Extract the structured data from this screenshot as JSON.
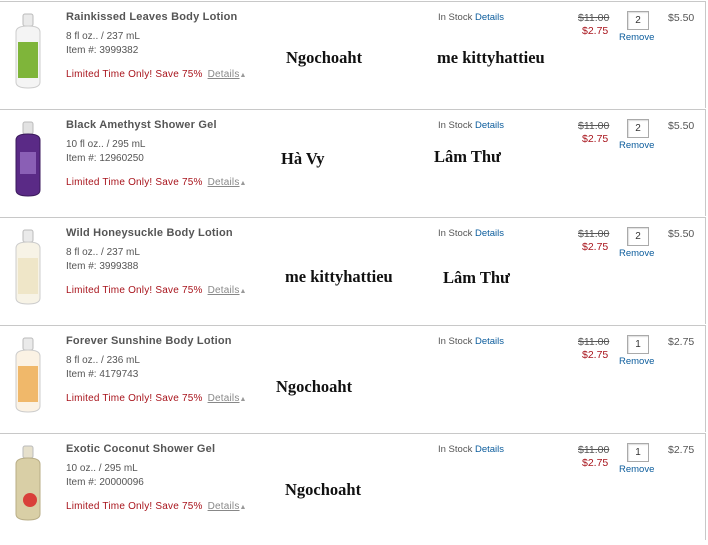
{
  "items": [
    {
      "name": "Rainkissed Leaves Body Lotion",
      "size": "8 fl oz.. / 237 mL",
      "item_no": "Item #: 3999382",
      "promo": "Limited Time Only! Save 75%",
      "promo_details": "Details",
      "stock": "In Stock",
      "stock_details": "Details",
      "old_price": "$11.00",
      "new_price": "$2.75",
      "qty": "2",
      "remove": "Remove",
      "total": "$5.50",
      "bottle_color": "#7fb53a",
      "overlay_left": "Ngochoaht",
      "overlay_right": "me  kittyhattieu"
    },
    {
      "name": "Black Amethyst Shower Gel",
      "size": "10 fl oz.. / 295 mL",
      "item_no": "Item #: 12960250",
      "promo": "Limited Time Only! Save 75%",
      "promo_details": "Details",
      "stock": "In Stock",
      "stock_details": "Details",
      "old_price": "$11.00",
      "new_price": "$2.75",
      "qty": "2",
      "remove": "Remove",
      "total": "$5.50",
      "bottle_color": "#5a2a86",
      "overlay_left": "Hà Vy",
      "overlay_right": "Lâm Thư"
    },
    {
      "name": "Wild Honeysuckle Body Lotion",
      "size": "8 fl oz.. / 237 mL",
      "item_no": "Item #: 3999388",
      "promo": "Limited Time Only! Save 75%",
      "promo_details": "Details",
      "stock": "In Stock",
      "stock_details": "Details",
      "old_price": "$11.00",
      "new_price": "$2.75",
      "qty": "2",
      "remove": "Remove",
      "total": "$5.50",
      "bottle_color": "#efe6c8",
      "overlay_left": "me  kittyhattieu",
      "overlay_right": "Lâm Thư"
    },
    {
      "name": "Forever Sunshine Body Lotion",
      "size": "8 fl oz.. / 236 mL",
      "item_no": "Item #: 4179743",
      "promo": "Limited Time Only! Save 75%",
      "promo_details": "Details",
      "stock": "In Stock",
      "stock_details": "Details",
      "old_price": "$11.00",
      "new_price": "$2.75",
      "qty": "1",
      "remove": "Remove",
      "total": "$2.75",
      "bottle_color": "#f0b86a",
      "overlay_left": "Ngochoaht",
      "overlay_right": ""
    },
    {
      "name": "Exotic Coconut Shower Gel",
      "size": "10 oz.. / 295 mL",
      "item_no": "Item #: 20000096",
      "promo": "Limited Time Only! Save 75%",
      "promo_details": "Details",
      "stock": "In Stock",
      "stock_details": "Details",
      "old_price": "$11.00",
      "new_price": "$2.75",
      "qty": "1",
      "remove": "Remove",
      "total": "$2.75",
      "bottle_color": "#d9cfa6",
      "overlay_left": "Ngochoaht",
      "overlay_right": ""
    }
  ]
}
